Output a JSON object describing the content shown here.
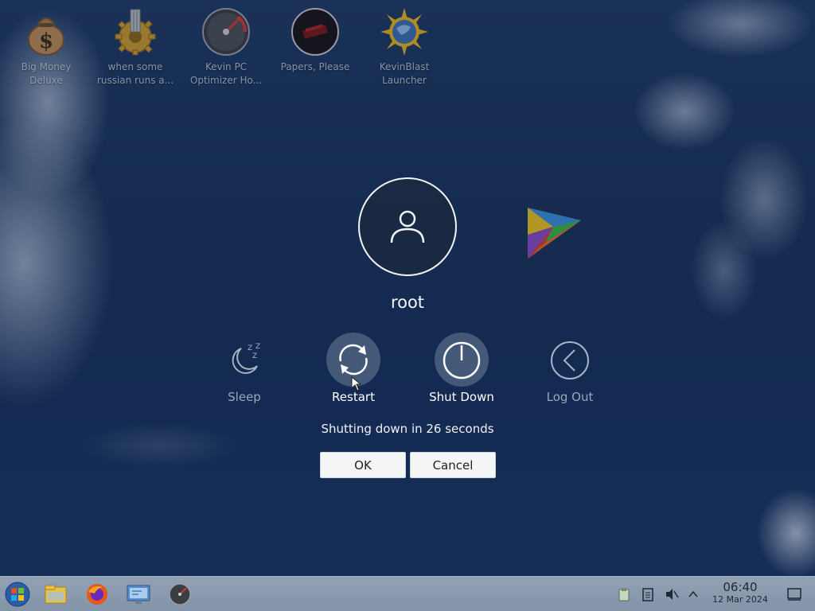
{
  "desktop": {
    "icons": [
      {
        "label": "Big Money\nDeluxe",
        "icon": "money-bag-icon"
      },
      {
        "label": "when some\nrussian runs a...",
        "icon": "gear-icon"
      },
      {
        "label": "Kevin PC\nOptimizer Ho...",
        "icon": "gauge-icon"
      },
      {
        "label": "Papers, Please",
        "icon": "papers-please-icon"
      },
      {
        "label": "KevinBlast\nLauncher",
        "icon": "sun-globe-icon"
      }
    ]
  },
  "dialog": {
    "username": "root",
    "actions": [
      {
        "label": "Sleep",
        "icon": "sleep-icon",
        "state": "dimmed"
      },
      {
        "label": "Restart",
        "icon": "restart-icon",
        "state": "highlighted"
      },
      {
        "label": "Shut Down",
        "icon": "power-icon",
        "state": "highlighted"
      },
      {
        "label": "Log Out",
        "icon": "logout-icon",
        "state": "dimmed"
      }
    ],
    "countdown": "Shutting down in 26 seconds",
    "ok_label": "OK",
    "cancel_label": "Cancel"
  },
  "taskbar": {
    "apps": [
      "start-orb-icon",
      "file-manager-icon",
      "firefox-icon",
      "system-settings-icon",
      "gauge-app-icon"
    ],
    "tray": [
      "clipboard-icon",
      "notes-icon",
      "volume-muted-icon",
      "chevron-up-icon"
    ],
    "clock": {
      "time": "06:40",
      "date": "12 Mar 2024"
    },
    "show_desktop": "show-desktop-icon"
  },
  "colors": {
    "sky": "#193358",
    "taskbar": "#8a99ad",
    "button": "#f4f5f7",
    "text_light": "#ffffff",
    "text_dim": "#9aa7ba"
  }
}
